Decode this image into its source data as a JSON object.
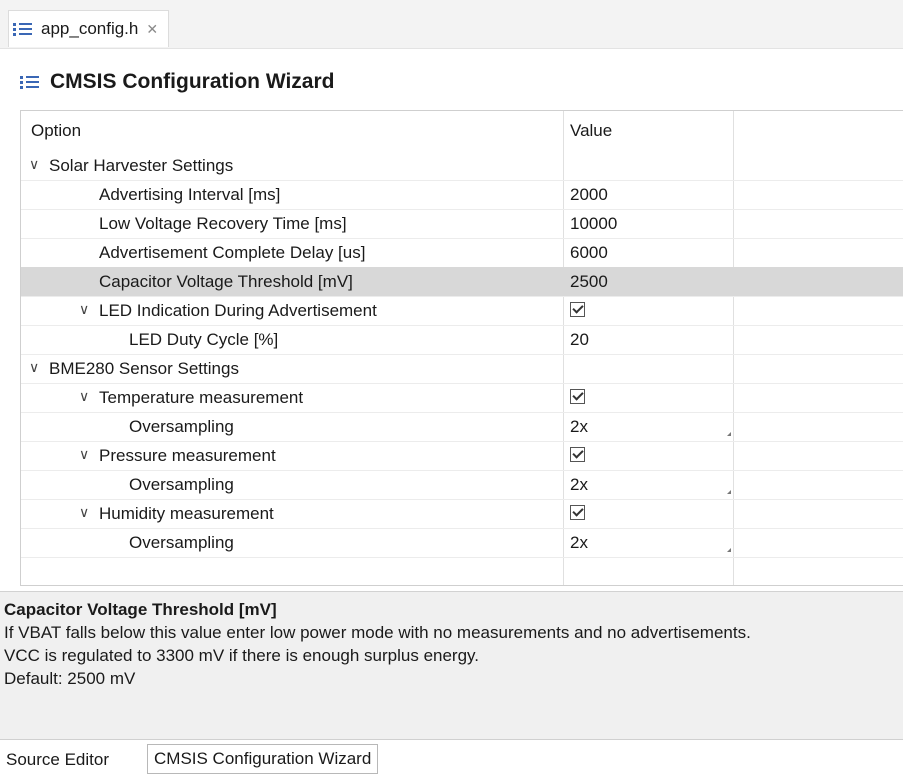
{
  "editor_tab": {
    "title": "app_config.h",
    "close": "☐"
  },
  "wizard": {
    "title": "CMSIS Configuration Wizard"
  },
  "table": {
    "headers": {
      "option": "Option",
      "value": "Value"
    },
    "rows": [
      {
        "option": "Solar Harvester Settings",
        "value": ""
      },
      {
        "option": "Advertising Interval [ms]",
        "value": "2000"
      },
      {
        "option": "Low Voltage Recovery Time [ms]",
        "value": "10000"
      },
      {
        "option": "Advertisement Complete Delay [us]",
        "value": "6000"
      },
      {
        "option": "Capacitor Voltage Threshold [mV]",
        "value": "2500"
      },
      {
        "option": "LED Indication During Advertisement",
        "value": ""
      },
      {
        "option": "LED Duty Cycle [%]",
        "value": "20"
      },
      {
        "option": "BME280 Sensor Settings",
        "value": ""
      },
      {
        "option": "Temperature measurement",
        "value": ""
      },
      {
        "option": "Oversampling",
        "value": "2x"
      },
      {
        "option": "Pressure measurement",
        "value": ""
      },
      {
        "option": "Oversampling",
        "value": "2x"
      },
      {
        "option": "Humidity measurement",
        "value": ""
      },
      {
        "option": "Oversampling",
        "value": "2x"
      }
    ]
  },
  "description": {
    "title": "Capacitor Voltage Threshold [mV]",
    "line1": "If VBAT falls below this value enter low power mode with no measurements and no advertisements.",
    "line2": "VCC is regulated to 3300 mV if there is enough surplus energy.",
    "line3": "Default: 2500 mV"
  },
  "bottom_tabs": {
    "source_editor": "Source Editor",
    "wizard": "CMSIS Configuration Wizard"
  },
  "colors": {
    "icon_blue": "#3a67b5",
    "selected_row": "#d8d8d8"
  }
}
